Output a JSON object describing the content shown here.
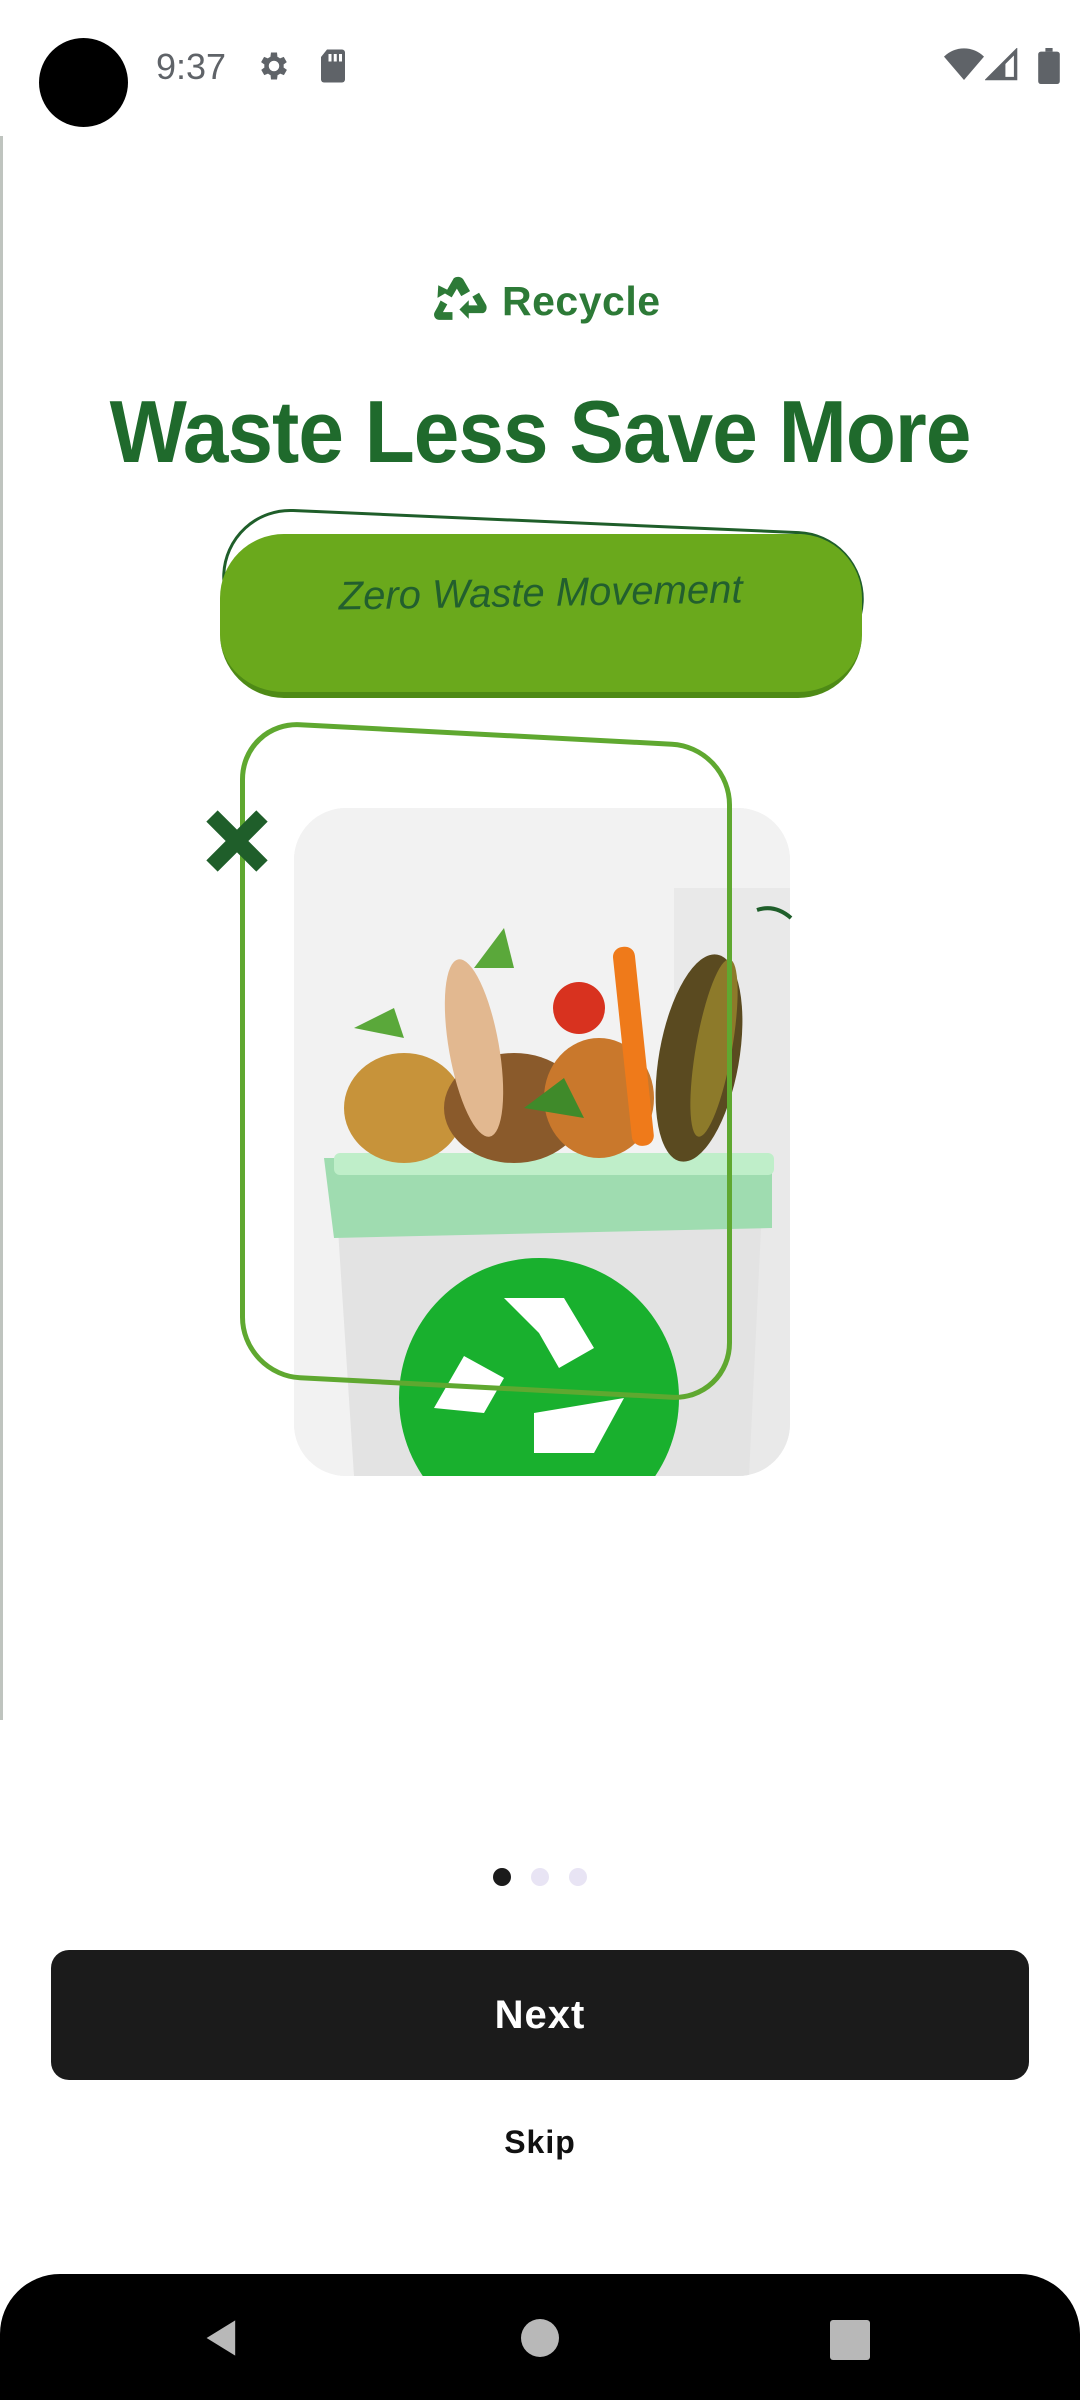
{
  "status_bar": {
    "time": "9:37",
    "icons": [
      "settings-icon",
      "sd-card-icon",
      "wifi-icon",
      "signal-icon",
      "battery-icon"
    ]
  },
  "onboarding": {
    "brand": "Recycle",
    "headline": "Waste Less Save More",
    "tagline": "Zero Waste Movement",
    "page_indicator": {
      "total": 3,
      "current": 1
    }
  },
  "actions": {
    "next_label": "Next",
    "skip_label": "Skip"
  },
  "navigation_bar": {
    "icons": [
      "back-icon",
      "home-icon",
      "recents-icon"
    ]
  },
  "colors": {
    "brand_dark_green": "#1f6a2c",
    "pill_green": "#6aa91c",
    "frame_green": "#5fa830",
    "button_dark": "#1b1b1b"
  }
}
